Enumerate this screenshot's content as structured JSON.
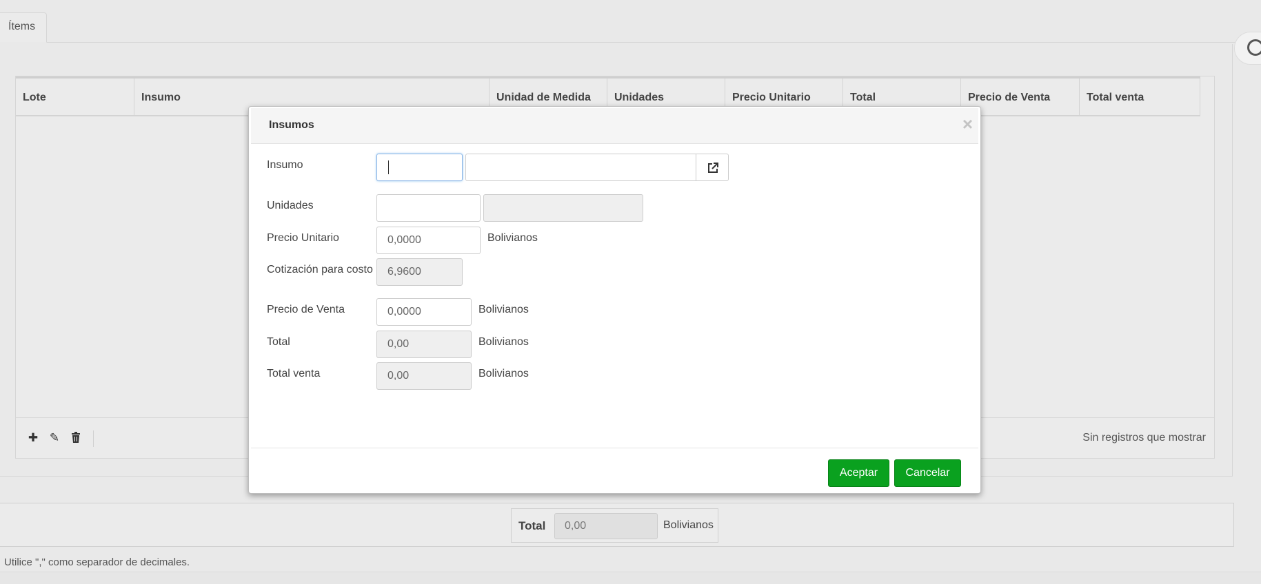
{
  "tabs": {
    "items_label": "Ítems"
  },
  "grid": {
    "columns": [
      "Lote",
      "Insumo",
      "Unidad de Medida",
      "Unidades",
      "Precio Unitario",
      "Total",
      "Precio de Venta",
      "Total venta"
    ],
    "empty_text": "Sin registros que mostrar",
    "toolbar": {
      "add_icon": "plus-icon",
      "edit_icon": "pencil-icon",
      "delete_icon": "trash-icon"
    }
  },
  "totals": {
    "label": "Total",
    "value": "0,00",
    "unit": "Bolivianos"
  },
  "hint": "Utilice \",\" como separador de decimales.",
  "modal": {
    "title": "Insumos",
    "fields": {
      "insumo": {
        "label": "Insumo",
        "code": "",
        "description": ""
      },
      "unidades": {
        "label": "Unidades",
        "value": "",
        "unit": ""
      },
      "precio_unitario": {
        "label": "Precio Unitario",
        "value": "0,0000",
        "unit": "Bolivianos"
      },
      "cotizacion": {
        "label": "Cotización para costo",
        "value": "6,9600"
      },
      "precio_venta": {
        "label": "Precio de Venta",
        "value": "0,0000",
        "unit": "Bolivianos"
      },
      "total": {
        "label": "Total",
        "value": "0,00",
        "unit": "Bolivianos"
      },
      "total_venta": {
        "label": "Total venta",
        "value": "0,00",
        "unit": "Bolivianos"
      }
    },
    "buttons": {
      "accept": "Aceptar",
      "cancel": "Cancelar"
    }
  },
  "colors": {
    "primary_button": "#0aa11f",
    "focus_border": "#8ab4e6"
  }
}
